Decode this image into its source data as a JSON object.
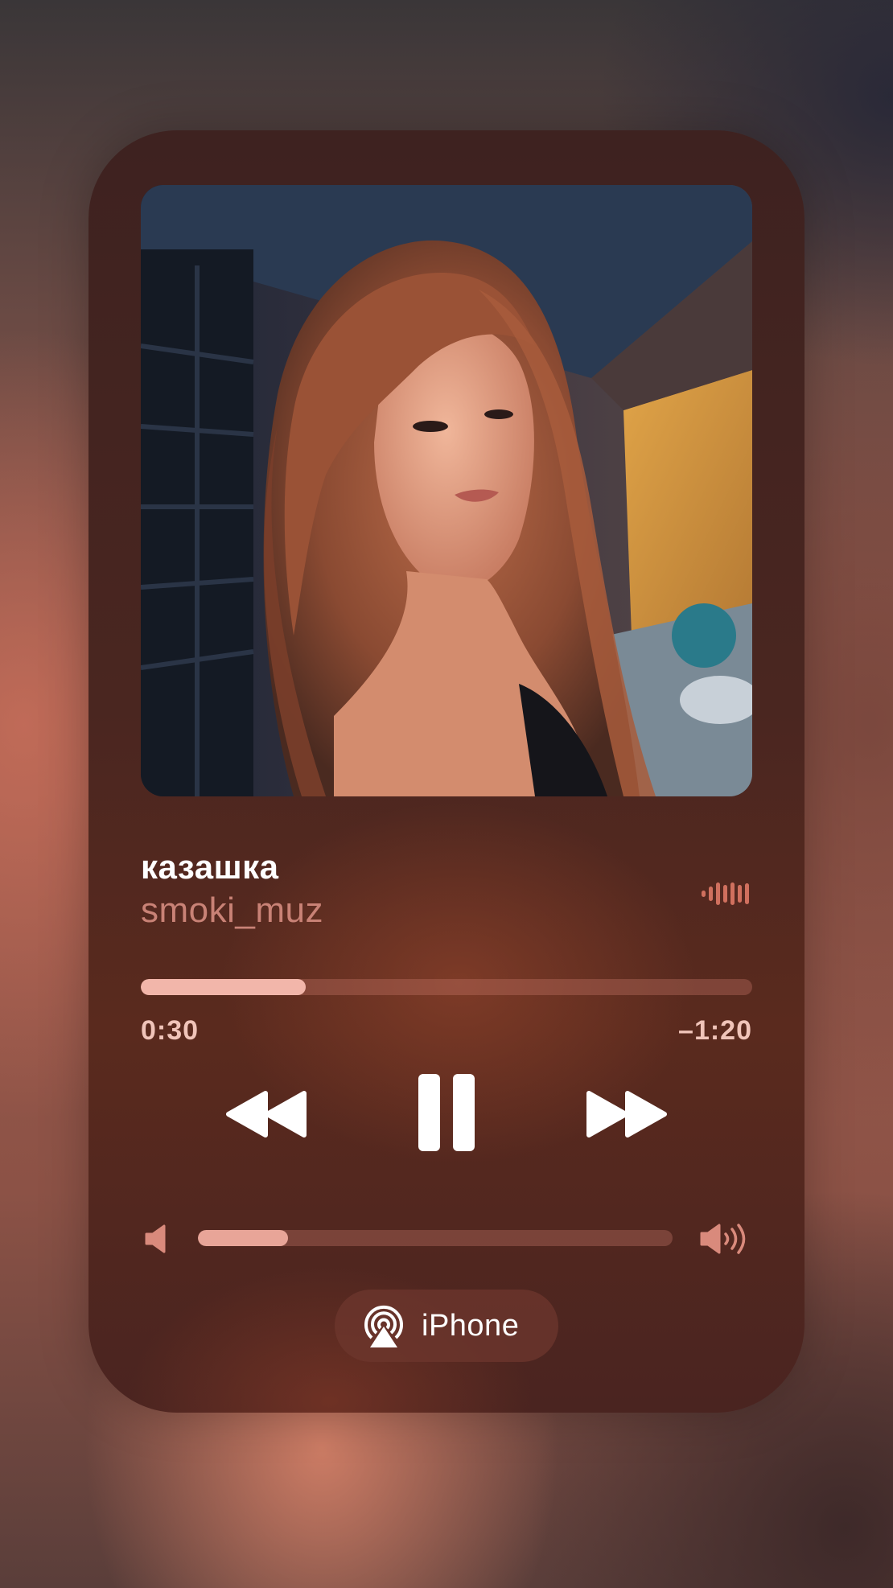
{
  "track": {
    "title": "казашка",
    "artist": "smoki_muz"
  },
  "playback": {
    "elapsed": "0:30",
    "remaining": "–1:20",
    "progress_fraction": 0.27
  },
  "volume": {
    "level_fraction": 0.19
  },
  "output": {
    "device_label": "iPhone",
    "icon": "airplay-icon"
  },
  "colors": {
    "accent": "#f2b6aa",
    "artist_text": "#c98276",
    "card_bg": "#4a2620"
  },
  "icons": [
    "waveform-icon",
    "rewind-icon",
    "pause-icon",
    "fast-forward-icon",
    "volume-low-icon",
    "volume-high-icon",
    "airplay-icon"
  ]
}
